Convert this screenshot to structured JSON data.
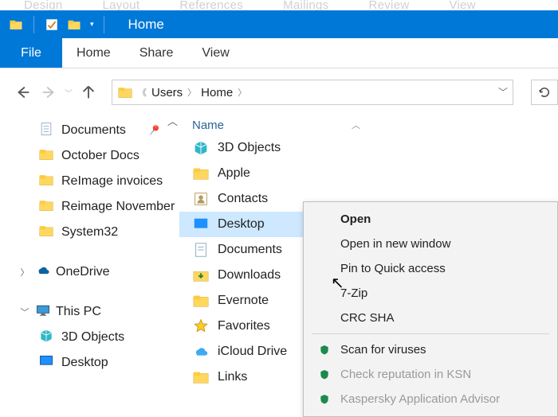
{
  "faint_ribbon": [
    "Design",
    "Layout",
    "References",
    "Mailings",
    "Review",
    "View"
  ],
  "titlebar": {
    "title": "Home"
  },
  "tabs": {
    "file": "File",
    "items": [
      "Home",
      "Share",
      "View"
    ]
  },
  "breadcrumb": {
    "items": [
      "Users",
      "Home"
    ]
  },
  "sidebar": {
    "quick": [
      {
        "label": "Documents",
        "icon": "doc",
        "pinned": true
      },
      {
        "label": "October Docs",
        "icon": "folder"
      },
      {
        "label": "ReImage invoices",
        "icon": "folder"
      },
      {
        "label": "Reimage November",
        "icon": "folder"
      },
      {
        "label": "System32",
        "icon": "folder"
      }
    ],
    "onedrive": "OneDrive",
    "thispc": "This PC",
    "thispc_children": [
      {
        "label": "3D Objects",
        "icon": "3d"
      },
      {
        "label": "Desktop",
        "icon": "desktop"
      }
    ]
  },
  "column_header": "Name",
  "files": [
    {
      "label": "3D Objects",
      "icon": "3d"
    },
    {
      "label": "Apple",
      "icon": "folder"
    },
    {
      "label": "Contacts",
      "icon": "contacts"
    },
    {
      "label": "Desktop",
      "icon": "desktop",
      "selected": true
    },
    {
      "label": "Documents",
      "icon": "doc"
    },
    {
      "label": "Downloads",
      "icon": "down"
    },
    {
      "label": "Evernote",
      "icon": "folder"
    },
    {
      "label": "Favorites",
      "icon": "fav"
    },
    {
      "label": "iCloud Drive",
      "icon": "icloud"
    },
    {
      "label": "Links",
      "icon": "links"
    }
  ],
  "context_menu": {
    "items": [
      {
        "label": "Open",
        "bold": true
      },
      {
        "label": "Open in new window"
      },
      {
        "label": "Pin to Quick access"
      },
      {
        "label": "7-Zip",
        "submenu": true
      },
      {
        "label": "CRC SHA",
        "submenu": true
      }
    ],
    "sep": true,
    "av_items": [
      {
        "label": "Scan for viruses",
        "icon": "shield"
      },
      {
        "label": "Check reputation in KSN",
        "icon": "shield",
        "disabled": true
      },
      {
        "label": "Kaspersky Application Advisor",
        "icon": "shield",
        "disabled": true
      }
    ]
  }
}
